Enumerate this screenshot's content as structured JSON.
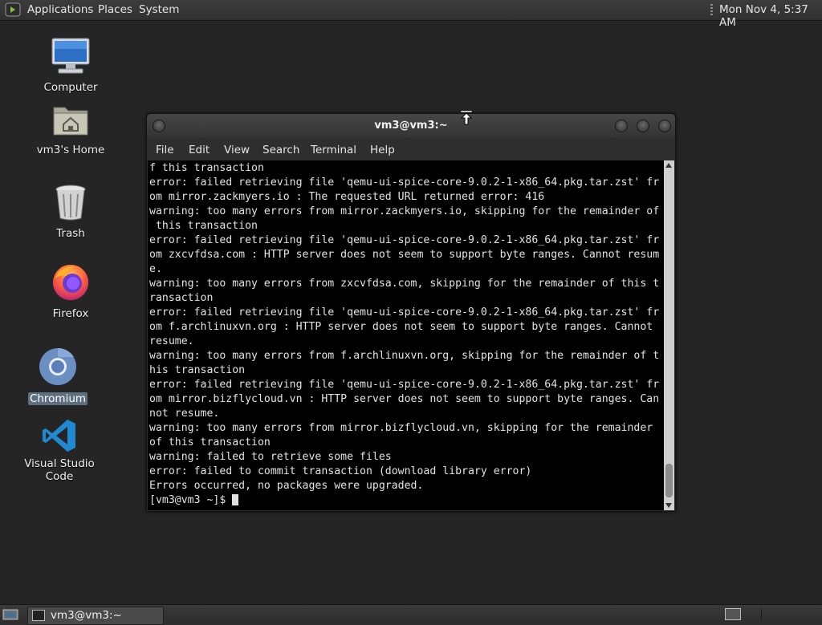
{
  "top_panel": {
    "menus": [
      "Applications",
      "Places",
      "System"
    ],
    "clock": "Mon Nov  4,  5:37 AM"
  },
  "desktop_icons": [
    {
      "label": "Computer",
      "icon": "computer-icon"
    },
    {
      "label": "vm3's Home",
      "icon": "home-folder-icon"
    },
    {
      "label": "Trash",
      "icon": "trash-icon"
    },
    {
      "label": "Firefox",
      "icon": "firefox-icon"
    },
    {
      "label": "Chromium",
      "icon": "chromium-icon",
      "selected": true
    },
    {
      "label": "Visual Studio Code",
      "icon": "vscode-icon"
    }
  ],
  "terminal": {
    "title": "vm3@vm3:~",
    "menu": [
      "File",
      "Edit",
      "View",
      "Search",
      "Terminal",
      "Help"
    ],
    "lines": [
      "f this transaction",
      "error: failed retrieving file 'qemu-ui-spice-core-9.0.2-1-x86_64.pkg.tar.zst' fr",
      "om mirror.zackmyers.io : The requested URL returned error: 416",
      "warning: too many errors from mirror.zackmyers.io, skipping for the remainder of",
      " this transaction",
      "error: failed retrieving file 'qemu-ui-spice-core-9.0.2-1-x86_64.pkg.tar.zst' fr",
      "om zxcvfdsa.com : HTTP server does not seem to support byte ranges. Cannot resum",
      "e.",
      "warning: too many errors from zxcvfdsa.com, skipping for the remainder of this t",
      "ransaction",
      "error: failed retrieving file 'qemu-ui-spice-core-9.0.2-1-x86_64.pkg.tar.zst' fr",
      "om f.archlinuxvn.org : HTTP server does not seem to support byte ranges. Cannot",
      "resume.",
      "warning: too many errors from f.archlinuxvn.org, skipping for the remainder of t",
      "his transaction",
      "error: failed retrieving file 'qemu-ui-spice-core-9.0.2-1-x86_64.pkg.tar.zst' fr",
      "om mirror.bizflycloud.vn : HTTP server does not seem to support byte ranges. Can",
      "not resume.",
      "warning: too many errors from mirror.bizflycloud.vn, skipping for the remainder",
      "of this transaction",
      "warning: failed to retrieve some files",
      "error: failed to commit transaction (download library error)",
      "Errors occurred, no packages were upgraded.",
      "[vm3@vm3 ~]$ "
    ]
  },
  "taskbar": {
    "tasks": [
      {
        "label": "vm3@vm3:~"
      }
    ]
  }
}
